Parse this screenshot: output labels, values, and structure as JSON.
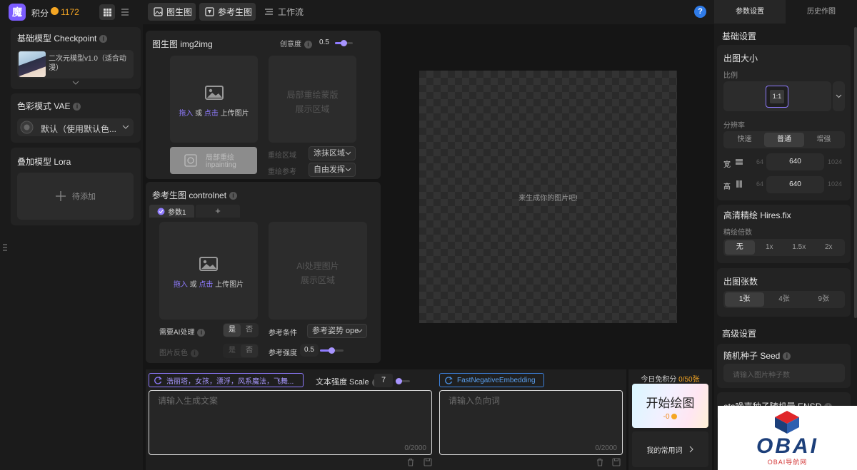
{
  "topbar": {
    "logo_glyph": "魔",
    "points_label": "积分",
    "points_value": "1172",
    "tabs": [
      {
        "label": "图生图",
        "active": true
      },
      {
        "label": "参考生图",
        "active": true
      },
      {
        "label": "工作流",
        "active": false
      }
    ],
    "help_glyph": "?"
  },
  "left": {
    "checkpoint_title": "基础模型 Checkpoint",
    "checkpoint_model": "二次元模型v1.0（适合动漫）",
    "vae_title": "色彩模式 VAE",
    "vae_value": "默认（使用默认色...",
    "lora_title": "叠加模型 Lora",
    "lora_add": "待添加"
  },
  "img2img": {
    "title": "图生图 img2img",
    "creativity_label": "创意度",
    "creativity_value": "0.5",
    "upload_drag": "拖入",
    "upload_or": " 或 ",
    "upload_click": "点击",
    "upload_suffix": " 上传图片",
    "mask_line1": "局部重绘蒙版",
    "mask_line2": "展示区域",
    "inpaint_line1": "局部重绘",
    "inpaint_line2": "inpainting",
    "repaint_area_label": "重绘区域",
    "repaint_area_value": "涂抹区域",
    "repaint_ref_label": "重绘参考",
    "repaint_ref_value": "自由发挥"
  },
  "controlnet": {
    "title": "参考生图 controlnet",
    "tab1": "参数1",
    "tab_add": "+",
    "upload_drag": "拖入",
    "upload_or": " 或 ",
    "upload_click": "点击",
    "upload_suffix": " 上传图片",
    "ai_line1": "AI处理图片",
    "ai_line2": "展示区域",
    "need_ai_label": "需要AI处理",
    "yes": "是",
    "no": "否",
    "invert_label": "图片反色",
    "invert_yes": "是",
    "invert_no": "否",
    "condition_label": "参考条件",
    "condition_value": "参考姿势 ope",
    "strength_label": "参考强度",
    "strength_value": "0.5"
  },
  "canvas": {
    "empty_text": "来生成你的图片吧!"
  },
  "prompt": {
    "tags": "浩丽塔，女孩，漂浮，风系魔法，飞舞...",
    "placeholder": "请输入生成文案",
    "count": "0/2000",
    "scale_label": "文本强度 Scale",
    "scale_value": "7"
  },
  "negative": {
    "tag": "FastNegativeEmbedding",
    "placeholder": "请输入负向词",
    "count": "0/2000"
  },
  "generate": {
    "free_label": "今日免积分",
    "free_used": "0",
    "free_total": "/50张",
    "button_label": "开始绘图",
    "cost": "-0",
    "common_words": "我的常用词"
  },
  "right": {
    "tabs": [
      "参数设置",
      "历史作图"
    ],
    "basic_header": "基础设置",
    "size_title": "出图大小",
    "ratio_label": "比例",
    "ratio_value": "1:1",
    "resolution_label": "分辨率",
    "resolution_options": [
      "快速",
      "普通",
      "增强"
    ],
    "width_label": "宽",
    "height_label": "高",
    "dim_min": "64",
    "dim_max": "1024",
    "width_value": "640",
    "height_value": "640",
    "hires_title": "高清精绘 Hires.fix",
    "hires_label": "精绘倍数",
    "hires_options": [
      "无",
      "1x",
      "1.5x",
      "2x"
    ],
    "count_title": "出图张数",
    "count_options": [
      "1张",
      "4张",
      "9张"
    ],
    "advanced_header": "高级设置",
    "seed_title": "随机种子 Seed",
    "seed_placeholder": "请输入图片种子数",
    "ensd_title": "eta噪声种子随机量 ENSD"
  },
  "watermark": {
    "brand": "OBAI",
    "sub": "OBAI导航网"
  },
  "colors": {
    "accent": "#8f7bff",
    "orange": "#f5a623",
    "blue": "#4a90e2"
  }
}
